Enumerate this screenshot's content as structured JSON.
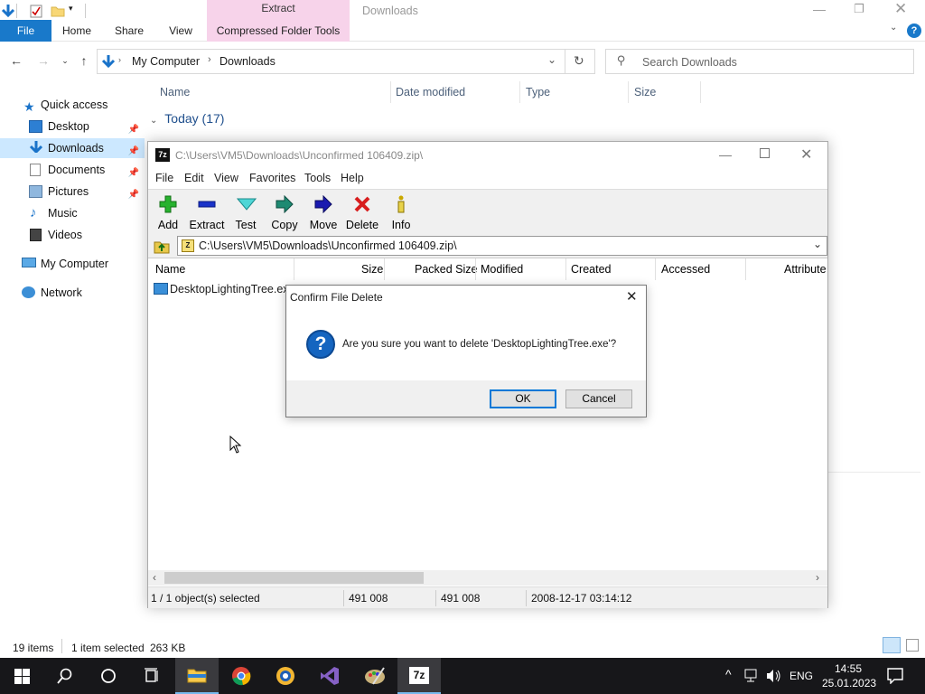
{
  "explorer": {
    "window_title": "Downloads",
    "context_tab": "Extract",
    "tabs": [
      "File",
      "Home",
      "Share",
      "View",
      "Compressed Folder Tools"
    ],
    "breadcrumb": [
      "My Computer",
      "Downloads"
    ],
    "search_placeholder": "Search Downloads",
    "nav": {
      "quick_access": "Quick access",
      "items": [
        "Desktop",
        "Downloads",
        "Documents",
        "Pictures",
        "Music",
        "Videos"
      ],
      "my_computer": "My Computer",
      "network": "Network"
    },
    "columns": [
      "Name",
      "Date modified",
      "Type",
      "Size"
    ],
    "group_header": "Today (17)",
    "status": {
      "item_count": "19 items",
      "selection": "1 item selected",
      "selection_size": "263 KB"
    }
  },
  "zip": {
    "title": "C:\\Users\\VM5\\Downloads\\Unconfirmed 106409.zip\\",
    "menu": [
      "File",
      "Edit",
      "View",
      "Favorites",
      "Tools",
      "Help"
    ],
    "toolbar": [
      "Add",
      "Extract",
      "Test",
      "Copy",
      "Move",
      "Delete",
      "Info"
    ],
    "path": "C:\\Users\\VM5\\Downloads\\Unconfirmed 106409.zip\\",
    "columns": [
      "Name",
      "Size",
      "Packed Size",
      "Modified",
      "Created",
      "Accessed",
      "Attribute"
    ],
    "rows": [
      {
        "name": "DesktopLightingTree.exe"
      }
    ],
    "status": {
      "selected": "1 / 1 object(s) selected",
      "size": "491 008",
      "packed": "491 008",
      "modified": "2008-12-17 03:14:12"
    }
  },
  "dialog": {
    "title": "Confirm File Delete",
    "message": "Are you sure you want to delete 'DesktopLightingTree.exe'?",
    "ok": "OK",
    "cancel": "Cancel"
  },
  "taskbar": {
    "language": "ENG",
    "time": "14:55",
    "date": "25.01.2023"
  },
  "colors": {
    "accent": "#0078d7",
    "file_tab": "#1979ca",
    "context_tab": "#f7d3ea",
    "taskbar": "#17171a"
  }
}
